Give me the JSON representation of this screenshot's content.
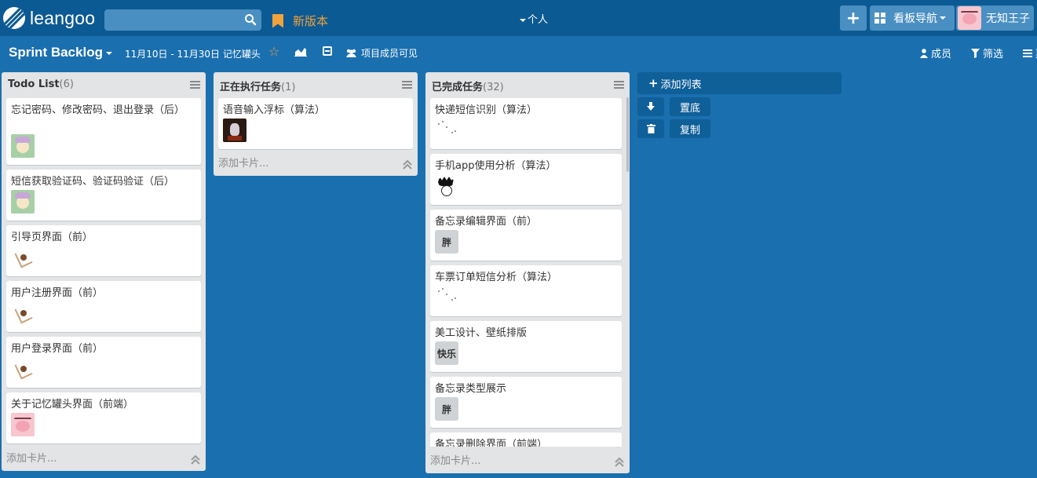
{
  "app": {
    "logo_text": "leangoo",
    "search_placeholder": "",
    "new_version_label": "新版本",
    "workspace_label": "个人",
    "board_nav_label": "看板导航",
    "user_name": "无知王子"
  },
  "board": {
    "title": "Sprint Backlog",
    "date_range": "11月10日 - 11月30日 记忆罐头",
    "visibility_label": "项目成员可见",
    "members_label": "成员",
    "filter_label": "筛选",
    "menu_label": "菜"
  },
  "lists": [
    {
      "name": "Todo List",
      "count": "(6)",
      "add_card_label": "添加卡片...",
      "cards": [
        {
          "title": "忘记密码、修改密码、退出登录（后）",
          "avatar": "anime-avatar"
        },
        {
          "title": "短信获取验证码、验证码验证（后）",
          "avatar": "anime-avatar"
        },
        {
          "title": "引导页界面（前）",
          "avatar": "sketch-avatar"
        },
        {
          "title": "用户注册界面（前）",
          "avatar": "sketch-avatar"
        },
        {
          "title": "用户登录界面（前）",
          "avatar": "sketch-avatar"
        },
        {
          "title": "关于记忆罐头界面（前端）",
          "avatar": "pig-avatar"
        }
      ]
    },
    {
      "name": "正在执行任务",
      "count": "(1)",
      "add_card_label": "添加卡片...",
      "cards": [
        {
          "title": "语音输入浮标（算法）",
          "avatar": "photo-avatar"
        }
      ]
    },
    {
      "name": "已完成任务",
      "count": "(32)",
      "add_card_label": "添加卡片...",
      "cards": [
        {
          "title": "快递短信识别（算法）",
          "avatar": "dots-avatar"
        },
        {
          "title": "手机app使用分析（算法）",
          "avatar": "hair-avatar"
        },
        {
          "title": "备忘录编辑界面（前）",
          "tag": "胖"
        },
        {
          "title": "车票订单短信分析（算法）",
          "avatar": "dots-avatar"
        },
        {
          "title": "美工设计、壁纸排版",
          "tag": "快乐"
        },
        {
          "title": "备忘录类型展示",
          "tag": "胖"
        },
        {
          "title": "备忘录删除界面（前端）"
        }
      ]
    }
  ],
  "add_list": {
    "label": "添加列表",
    "move_bottom_label": "置底",
    "copy_label": "复制"
  },
  "colors": {
    "board_bg": "#1a6faf",
    "topbar_bg": "#0c5a93",
    "accent_orange": "#f0a23c",
    "list_bg": "#e2e4e6"
  }
}
